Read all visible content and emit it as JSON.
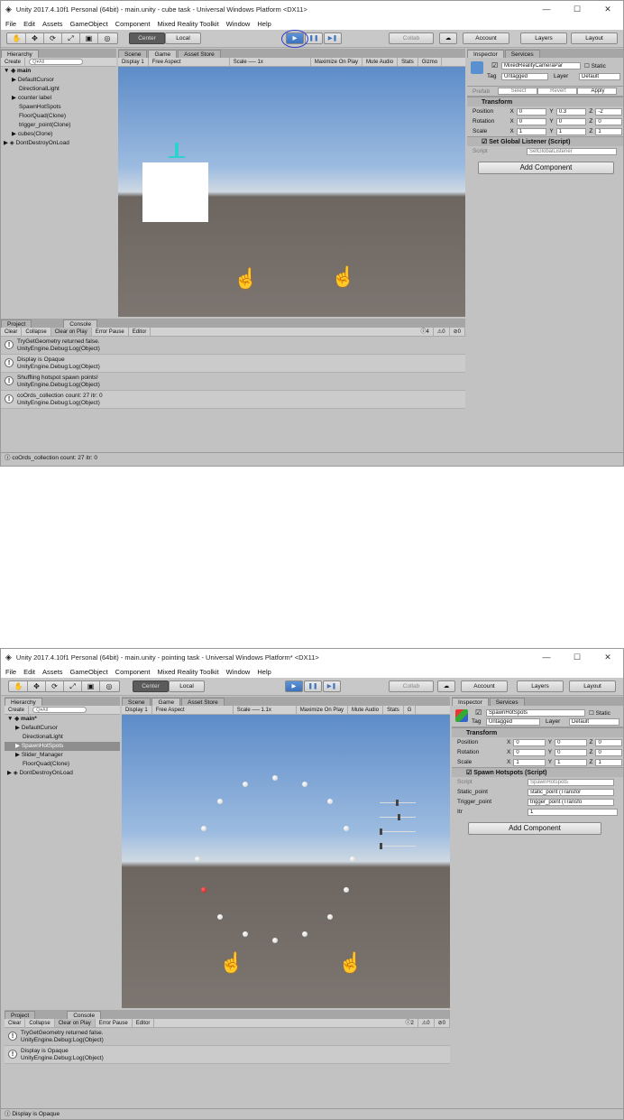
{
  "windows": [
    {
      "title": "Unity 2017.4.10f1 Personal (64bit) - main.unity - cube task - Universal Windows Platform <DX11>",
      "menu": [
        "File",
        "Edit",
        "Assets",
        "GameObject",
        "Component",
        "Mixed Reality Toolkit",
        "Window",
        "Help"
      ],
      "toolbar": {
        "center": "Center",
        "local": "Local",
        "collab": "Collab",
        "account": "Account",
        "layers": "Layers",
        "layout": "Layout"
      },
      "hierarchy": {
        "tab": "Hierarchy",
        "create": "Create",
        "search": "Q▾All",
        "scene_name": "main",
        "items": [
          "DefaultCursor",
          "DirectionalLight",
          "counter label",
          "SpawnHotSpots",
          "FloorQuad(Clone)",
          "trigger_point(Clone)",
          "cubes(Clone)"
        ],
        "dont_destroy": "DontDestroyOnLoad"
      },
      "game": {
        "tabs": [
          "Scene",
          "Game",
          "Asset Store"
        ],
        "display": "Display 1",
        "aspect": "Free Aspect",
        "scale_label": "Scale",
        "scale_value": "1x",
        "maximize": "Maximize On Play",
        "mute": "Mute Audio",
        "stats": "Stats",
        "gizmos": "Gizmo"
      },
      "bottom": {
        "tabs": [
          "Project",
          "Console"
        ],
        "buttons": [
          "Clear",
          "Collapse",
          "Clear on Play",
          "Error Pause",
          "Editor"
        ],
        "counts": [
          "4",
          "0",
          "0"
        ],
        "messages": [
          {
            "line1": "TryGetGeometry returned false.",
            "line2": "UnityEngine.Debug:Log(Object)"
          },
          {
            "line1": "Display is Opaque",
            "line2": "UnityEngine.Debug:Log(Object)"
          },
          {
            "line1": "Shuffling hotspot spawn points!",
            "line2": "UnityEngine.Debug:Log(Object)"
          },
          {
            "line1": "coOrds_collection count: 27 itr: 0",
            "line2": "UnityEngine.Debug:Log(Object)"
          }
        ]
      },
      "inspector": {
        "tabs": [
          "Inspector",
          "Services"
        ],
        "object_name": "MixedRealityCameraPar",
        "static": "Static",
        "tag_label": "Tag",
        "tag": "Untagged",
        "layer_label": "Layer",
        "layer": "Default",
        "prefab": "Prefab",
        "select": "Select",
        "revert": "Revert",
        "apply": "Apply",
        "transform": "Transform",
        "pos_label": "Position",
        "rot_label": "Rotation",
        "scale_label": "Scale",
        "position": [
          "0",
          "0.3",
          "-2"
        ],
        "rotation": [
          "0",
          "0",
          "0"
        ],
        "scale": [
          "1",
          "1",
          "1"
        ],
        "script_comp": "Set Global Listener (Script)",
        "script_label": "Script",
        "script_value": "SetGlobalListener",
        "add_component": "Add Component"
      },
      "status": "coOrds_collection count: 27 itr: 0"
    },
    {
      "title": "Unity 2017.4.10f1 Personal (64bit) - main.unity - pointing task - Universal Windows Platform* <DX11>",
      "menu": [
        "File",
        "Edit",
        "Assets",
        "GameObject",
        "Component",
        "Mixed Reality Toolkit",
        "Window",
        "Help"
      ],
      "toolbar": {
        "center": "Center",
        "local": "Local",
        "collab": "Collab",
        "account": "Account",
        "layers": "Layers",
        "layout": "Layout"
      },
      "hierarchy": {
        "tab": "Hierarchy",
        "create": "Create",
        "search": "Q▾All",
        "scene_name": "main*",
        "items": [
          "DefaultCursor",
          "DirectionalLight",
          "SpawnHotSpots",
          "Slider_Manager",
          "FloorQuad(Clone)"
        ],
        "dont_destroy": "DontDestroyOnLoad"
      },
      "game": {
        "tabs": [
          "Scene",
          "Game",
          "Asset Store"
        ],
        "display": "Display 1",
        "aspect": "Free Aspect",
        "scale_label": "Scale",
        "scale_value": "1.1x",
        "maximize": "Maximize On Play",
        "mute": "Mute Audio",
        "stats": "Stats",
        "gizmos": "G"
      },
      "bottom": {
        "tabs": [
          "Project",
          "Console"
        ],
        "buttons": [
          "Clear",
          "Collapse",
          "Clear on Play",
          "Error Pause",
          "Editor"
        ],
        "counts": [
          "2",
          "0",
          "0"
        ],
        "messages": [
          {
            "line1": "TryGetGeometry returned false.",
            "line2": "UnityEngine.Debug:Log(Object)"
          },
          {
            "line1": "Display is Opaque",
            "line2": "UnityEngine.Debug:Log(Object)"
          }
        ]
      },
      "inspector": {
        "tabs": [
          "Inspector",
          "Services"
        ],
        "object_name": "SpawnHotSpots",
        "static": "Static",
        "tag_label": "Tag",
        "tag": "Untagged",
        "layer_label": "Layer",
        "layer": "Default",
        "transform": "Transform",
        "pos_label": "Position",
        "rot_label": "Rotation",
        "scale_label": "Scale",
        "position": [
          "0",
          "0",
          "0"
        ],
        "rotation": [
          "0",
          "0",
          "0"
        ],
        "scale": [
          "1",
          "1",
          "1"
        ],
        "script_comp": "Spawn Hotspots (Script)",
        "script_label": "Script",
        "script_value": "SpawnHotspots",
        "fields": [
          {
            "label": "Static_point",
            "value": "static_point (Transfor"
          },
          {
            "label": "Trigger_point",
            "value": "trigger_point (Transfo"
          },
          {
            "label": "Itr",
            "value": "1"
          }
        ],
        "add_component": "Add Component"
      },
      "status": "Display is Opaque"
    }
  ]
}
